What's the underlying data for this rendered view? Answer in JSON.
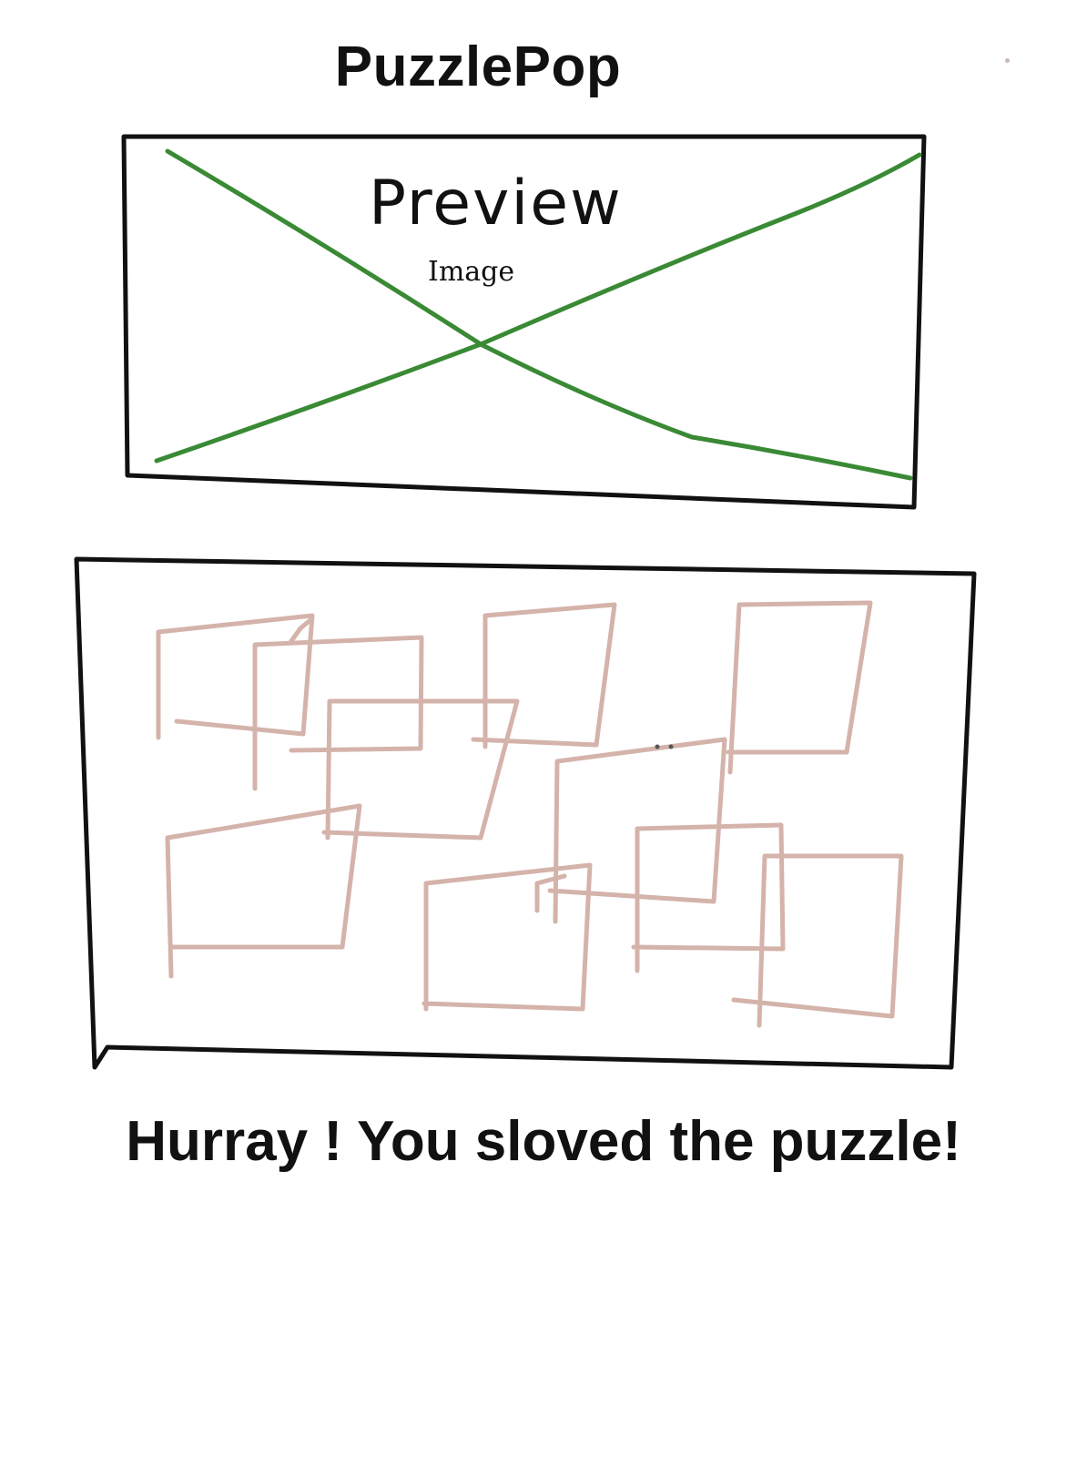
{
  "app": {
    "title": "PuzzlePop"
  },
  "preview": {
    "label": "Preview",
    "sublabel": "Image"
  },
  "board": {
    "piece_count": 12,
    "piece_color": "#d4b3ab"
  },
  "status": {
    "message": "Hurray ! You sloved the puzzle!"
  },
  "colors": {
    "frame": "#111111",
    "placeholder_cross": "#3a8a35"
  }
}
